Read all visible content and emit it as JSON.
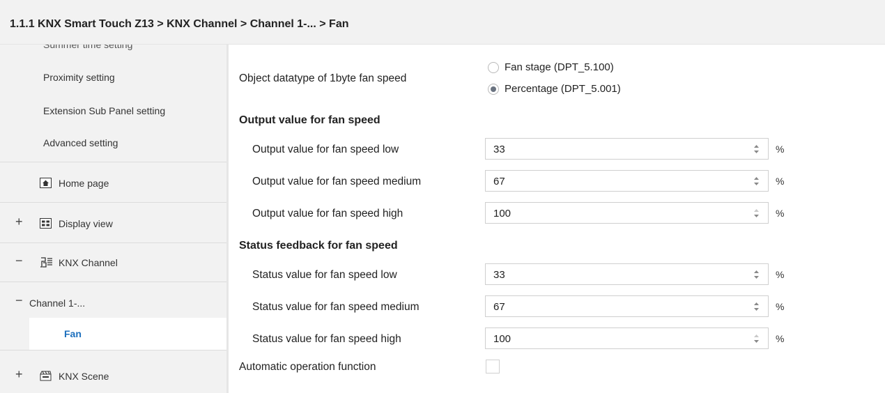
{
  "header": {
    "breadcrumb": "1.1.1 KNX Smart Touch Z13 > KNX Channel  > Channel 1-... > Fan"
  },
  "sidebar": {
    "cut_item": "Summer time setting",
    "items": [
      {
        "label": "Proximity setting"
      },
      {
        "label": "Extension Sub Panel setting"
      },
      {
        "label": "Advanced setting"
      },
      {
        "label": "Home page",
        "icon": "home-icon"
      },
      {
        "label": "Display view",
        "icon": "display-view-icon",
        "expander": "+"
      },
      {
        "label": "KNX Channel",
        "icon": "knx-channel-icon",
        "expander": "−"
      },
      {
        "label": "Channel 1-...",
        "expander": "−"
      },
      {
        "label": "Fan",
        "selected": true
      },
      {
        "label": "KNX Scene",
        "icon": "scene-icon",
        "expander": "+"
      }
    ]
  },
  "form": {
    "datatype": {
      "label": "Object datatype of 1byte fan speed",
      "options": [
        "Fan stage (DPT_5.100)",
        "Percentage (DPT_5.001)"
      ],
      "selected": "Percentage (DPT_5.001)"
    },
    "output_section": "Output value for fan speed",
    "output": [
      {
        "label": "Output value for fan speed low",
        "value": "33",
        "unit": "%"
      },
      {
        "label": "Output value for fan speed medium",
        "value": "67",
        "unit": "%"
      },
      {
        "label": "Output value for fan speed high",
        "value": "100",
        "unit": "%"
      }
    ],
    "status_section": "Status feedback for fan speed",
    "status": [
      {
        "label": "Status value for fan speed low",
        "value": "33",
        "unit": "%"
      },
      {
        "label": "Status value for fan speed medium",
        "value": "67",
        "unit": "%"
      },
      {
        "label": "Status value for fan speed high",
        "value": "100",
        "unit": "%"
      }
    ],
    "auto": {
      "label": "Automatic operation function",
      "checked": false
    }
  },
  "colors": {
    "accent": "#1c6fbd",
    "sidebar_bg": "#f2f2f2",
    "header_bg": "#f2f2f2"
  }
}
